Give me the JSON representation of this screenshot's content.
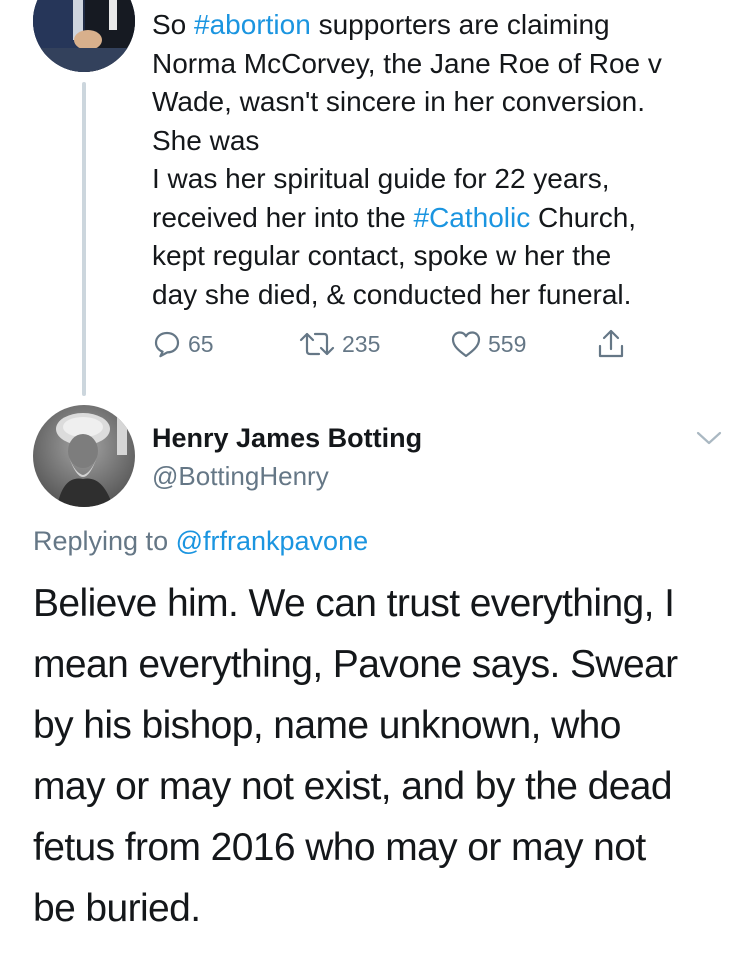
{
  "parent_tweet": {
    "lines": [
      {
        "pre": "So ",
        "tag": "#abortion",
        "post": " supporters are claiming"
      },
      {
        "pre": "Norma McCorvey, the Jane Roe of Roe v",
        "tag": "",
        "post": ""
      },
      {
        "pre": "Wade, wasn't sincere in her conversion.",
        "tag": "",
        "post": ""
      },
      {
        "pre": "She was",
        "tag": "",
        "post": ""
      },
      {
        "pre": "I was her spiritual guide for 22 years,",
        "tag": "",
        "post": ""
      },
      {
        "pre": "received her into the ",
        "tag": "#Catholic",
        "post": " Church,"
      },
      {
        "pre": "kept regular contact, spoke w her the",
        "tag": "",
        "post": ""
      },
      {
        "pre": "day she died, & conducted her funeral.",
        "tag": "",
        "post": ""
      }
    ],
    "actions": {
      "reply_count": "65",
      "retweet_count": "235",
      "like_count": "559"
    }
  },
  "reply_tweet": {
    "author_name": "Henry James Botting",
    "author_handle": "@BottingHenry",
    "replying_prefix": "Replying to ",
    "replying_handle": "@frfrankpavone",
    "body_lines": [
      "Believe him. We can trust everything, I",
      "mean everything, Pavone says. Swear",
      "by his bishop, name unknown, who",
      "may or may not exist, and by the dead",
      "fetus from 2016 who may or may not",
      "be buried."
    ]
  },
  "icons": {
    "reply": "reply-icon",
    "retweet": "retweet-icon",
    "like": "heart-icon",
    "share": "share-icon",
    "menu": "chevron-down-icon"
  },
  "colors": {
    "link": "#1b95e0",
    "muted": "#657786",
    "text": "#14171a",
    "thread_line": "#ccd6dd"
  }
}
